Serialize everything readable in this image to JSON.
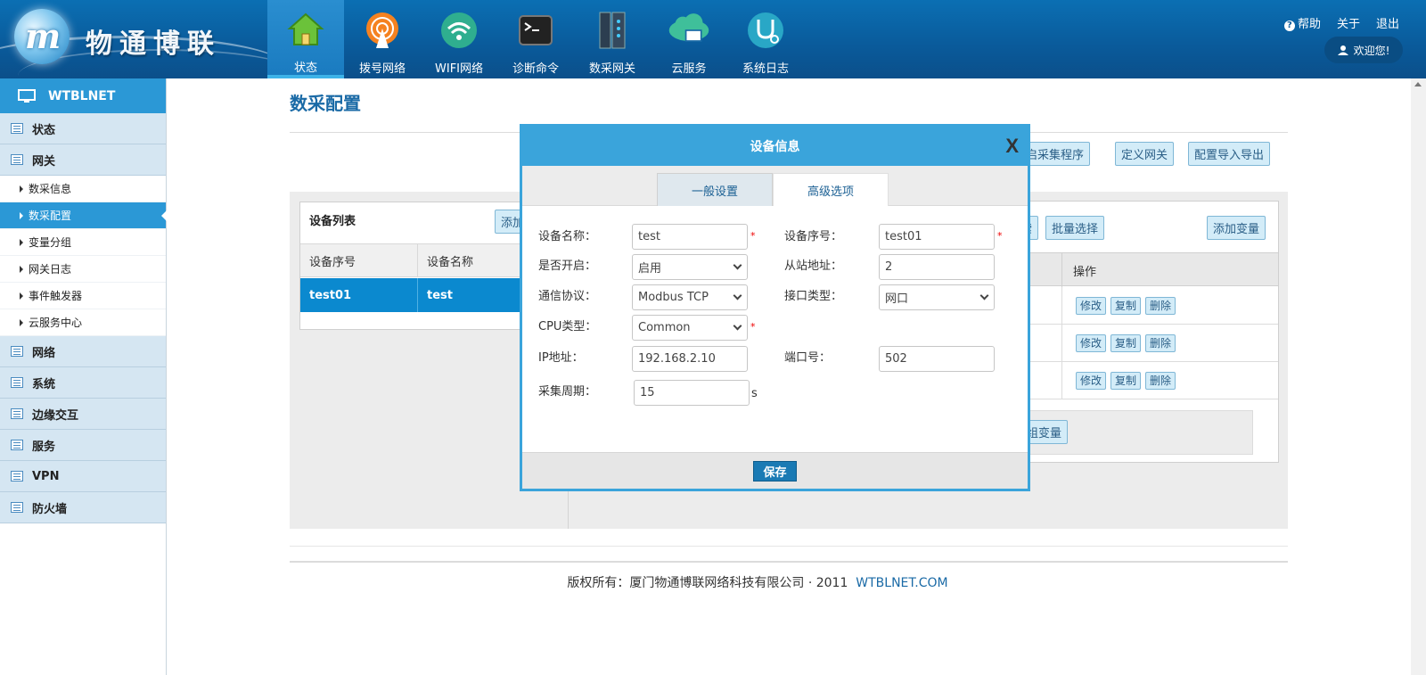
{
  "brand": {
    "logo_glyph": "m",
    "name": "物通博联"
  },
  "nav": [
    {
      "label": "状态",
      "icon": "home-icon",
      "active": true
    },
    {
      "label": "拨号网络",
      "icon": "signal-tower-icon"
    },
    {
      "label": "WIFI网络",
      "icon": "wifi-icon"
    },
    {
      "label": "诊断命令",
      "icon": "terminal-icon"
    },
    {
      "label": "数采网关",
      "icon": "gateway-device-icon"
    },
    {
      "label": "云服务",
      "icon": "cloud-icon"
    },
    {
      "label": "系统日志",
      "icon": "stethoscope-icon"
    }
  ],
  "top_links": {
    "help": "帮助",
    "help_glyph": "?",
    "about": "关于",
    "logout": "退出",
    "welcome": "欢迎您!"
  },
  "sidebar": {
    "title": "WTBLNET",
    "groups_top": [
      {
        "label": "状态"
      },
      {
        "label": "网关"
      }
    ],
    "gateway_items": [
      {
        "label": "数采信息"
      },
      {
        "label": "数采配置",
        "active": true
      },
      {
        "label": "变量分组"
      },
      {
        "label": "网关日志"
      },
      {
        "label": "事件触发器"
      },
      {
        "label": "云服务中心"
      }
    ],
    "groups_bottom": [
      {
        "label": "网络"
      },
      {
        "label": "系统"
      },
      {
        "label": "边缘交互"
      },
      {
        "label": "服务"
      },
      {
        "label": "VPN"
      },
      {
        "label": "防火墙"
      }
    ]
  },
  "main": {
    "title": "数采配置",
    "top_buttons": {
      "restart": "重启采集程序",
      "define_gateway": "定义网关",
      "import_export": "配置导入导出"
    },
    "device_list": {
      "title": "设备列表",
      "add_button": "添加",
      "columns": [
        "设备序号",
        "设备名称"
      ],
      "rows": [
        {
          "id": "test01",
          "name": "test"
        }
      ]
    },
    "variables": {
      "search_button": "搜索",
      "batch_select_button": "批量选择",
      "add_variable_button": "添加变量",
      "op_header": "操作",
      "row_actions": {
        "edit": "修改",
        "copy": "复制",
        "delete": "删除"
      },
      "group_variable_button": "分组变量"
    }
  },
  "modal": {
    "title": "设备信息",
    "close": "X",
    "tabs": {
      "general": "一般设置",
      "advanced": "高级选项"
    },
    "fields": {
      "device_name_label": "设备名称：",
      "device_name": "test",
      "device_id_label": "设备序号：",
      "device_id": "test01",
      "enabled_label": "是否开启：",
      "enabled": "启用",
      "slave_label": "从站地址：",
      "slave": "2",
      "protocol_label": "通信协议：",
      "protocol": "Modbus TCP",
      "iface_label": "接口类型：",
      "iface": "网口",
      "cpu_label": "CPU类型：",
      "cpu": "Common",
      "ip_label": "IP地址：",
      "ip": "192.168.2.10",
      "port_label": "端口号：",
      "port": "502",
      "period_label": "采集周期：",
      "period": "15",
      "period_unit": "s",
      "required_mark": "*"
    },
    "save": "保存"
  },
  "footer": {
    "text": "版权所有：厦门物通博联网络科技有限公司 · 2011",
    "link": "WTBLNET.COM"
  }
}
